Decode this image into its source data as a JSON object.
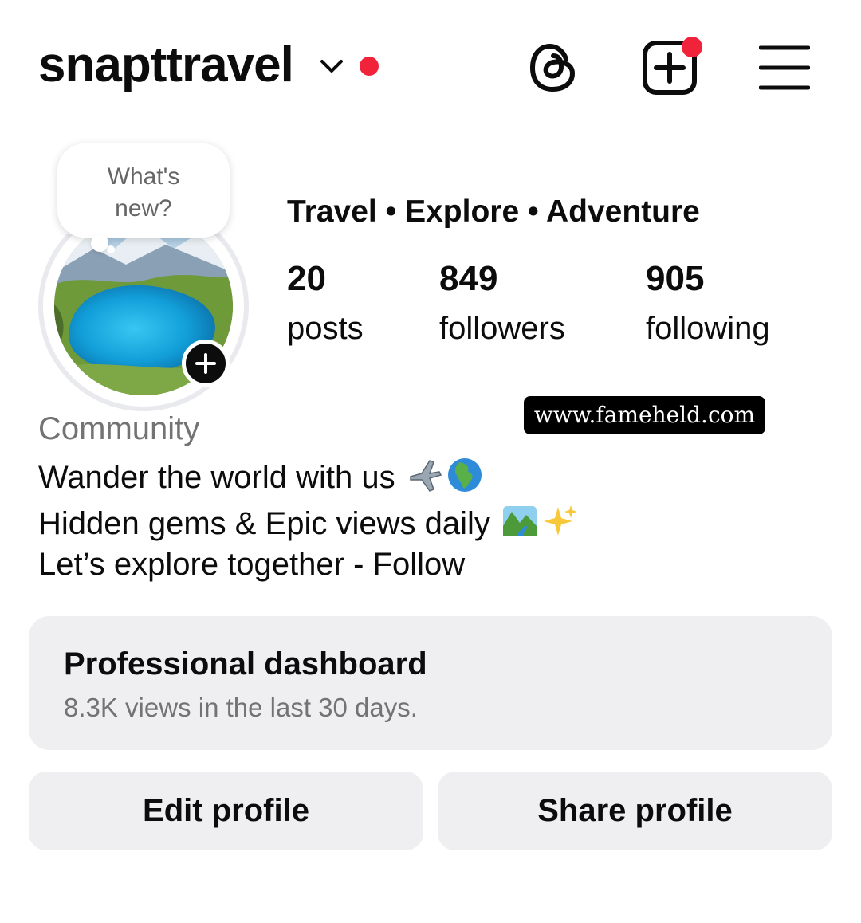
{
  "header": {
    "username": "snapttravel",
    "dropdown_icon": "chevron-down-icon",
    "notification_color": "#f0233b",
    "threads_icon": "threads-icon",
    "new_post_icon": "plus-square-icon",
    "menu_icon": "hamburger-menu-icon"
  },
  "story_bubble": {
    "line1": "What's",
    "line2": "new?"
  },
  "profile": {
    "tagline": "Travel • Explore • Adventure",
    "stats": [
      {
        "value": "20",
        "label": "posts"
      },
      {
        "value": "849",
        "label": "followers"
      },
      {
        "value": "905",
        "label": "following"
      }
    ],
    "category": "Community",
    "bio": [
      "Wander the world with us",
      "Hidden gems & Epic views daily",
      "Let’s explore together - Follow"
    ],
    "bio_emojis": [
      [
        "airplane-icon",
        "globe-africa-icon"
      ],
      [
        "national-park-icon",
        "sparkles-icon"
      ]
    ]
  },
  "watermark": "www.fameheld.com",
  "dashboard": {
    "title": "Professional dashboard",
    "subtitle": "8.3K views in the last 30 days."
  },
  "actions": {
    "edit": "Edit profile",
    "share": "Share profile"
  }
}
